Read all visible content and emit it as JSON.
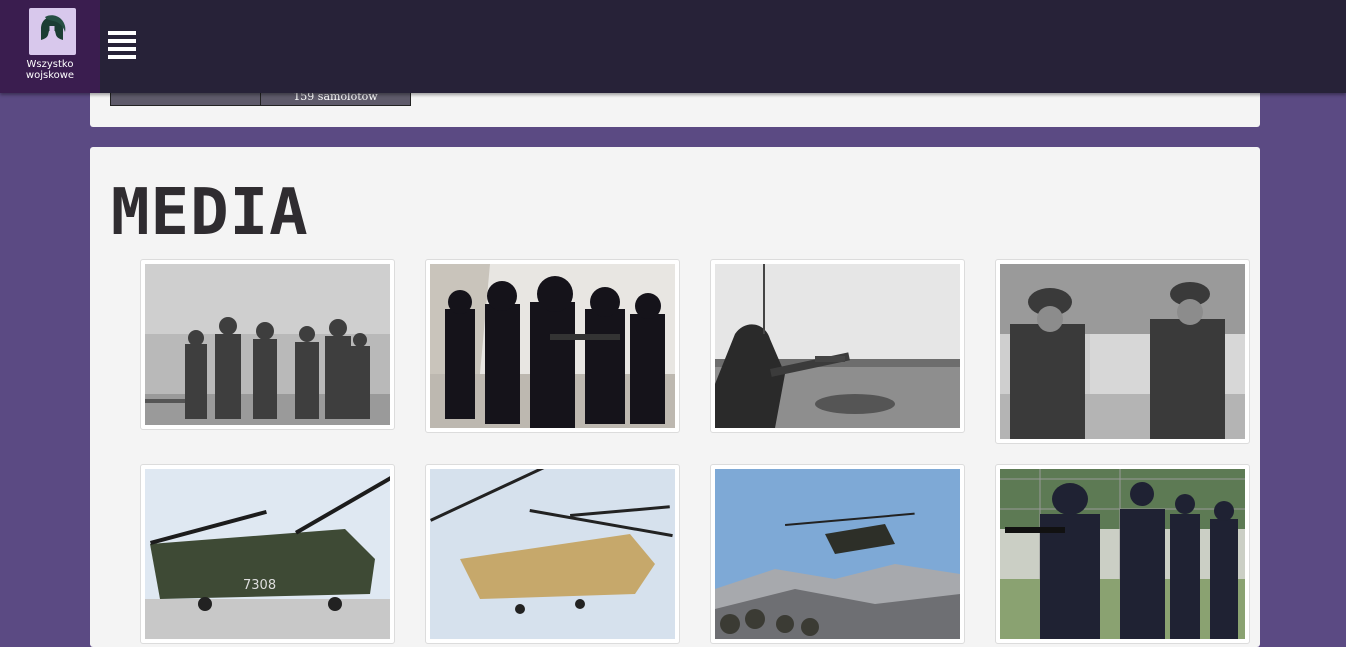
{
  "brand": {
    "name": "Wszystko\nwojskowe",
    "logo_icon": "spartan-helmet-icon",
    "accent": "#3a1d4f"
  },
  "nav": {
    "menu_icon": "hamburger-menu-icon"
  },
  "stats": {
    "cells": [
      "",
      "159 samolotów"
    ]
  },
  "media": {
    "title": "Media",
    "items": [
      {
        "name": "media-officers-in-snow",
        "alt": "officers in snow"
      },
      {
        "name": "media-swat-team",
        "alt": "armed police team"
      },
      {
        "name": "media-tank-commander",
        "alt": "tank commander"
      },
      {
        "name": "media-two-officers",
        "alt": "two officers"
      },
      {
        "name": "media-chinook-parked",
        "alt": "parked helicopter 7308"
      },
      {
        "name": "media-chinook-flying",
        "alt": "tan helicopter flying"
      },
      {
        "name": "media-chinook-mountains",
        "alt": "helicopter over mountains"
      },
      {
        "name": "media-gas-mask-police",
        "alt": "police in gas masks"
      }
    ]
  }
}
